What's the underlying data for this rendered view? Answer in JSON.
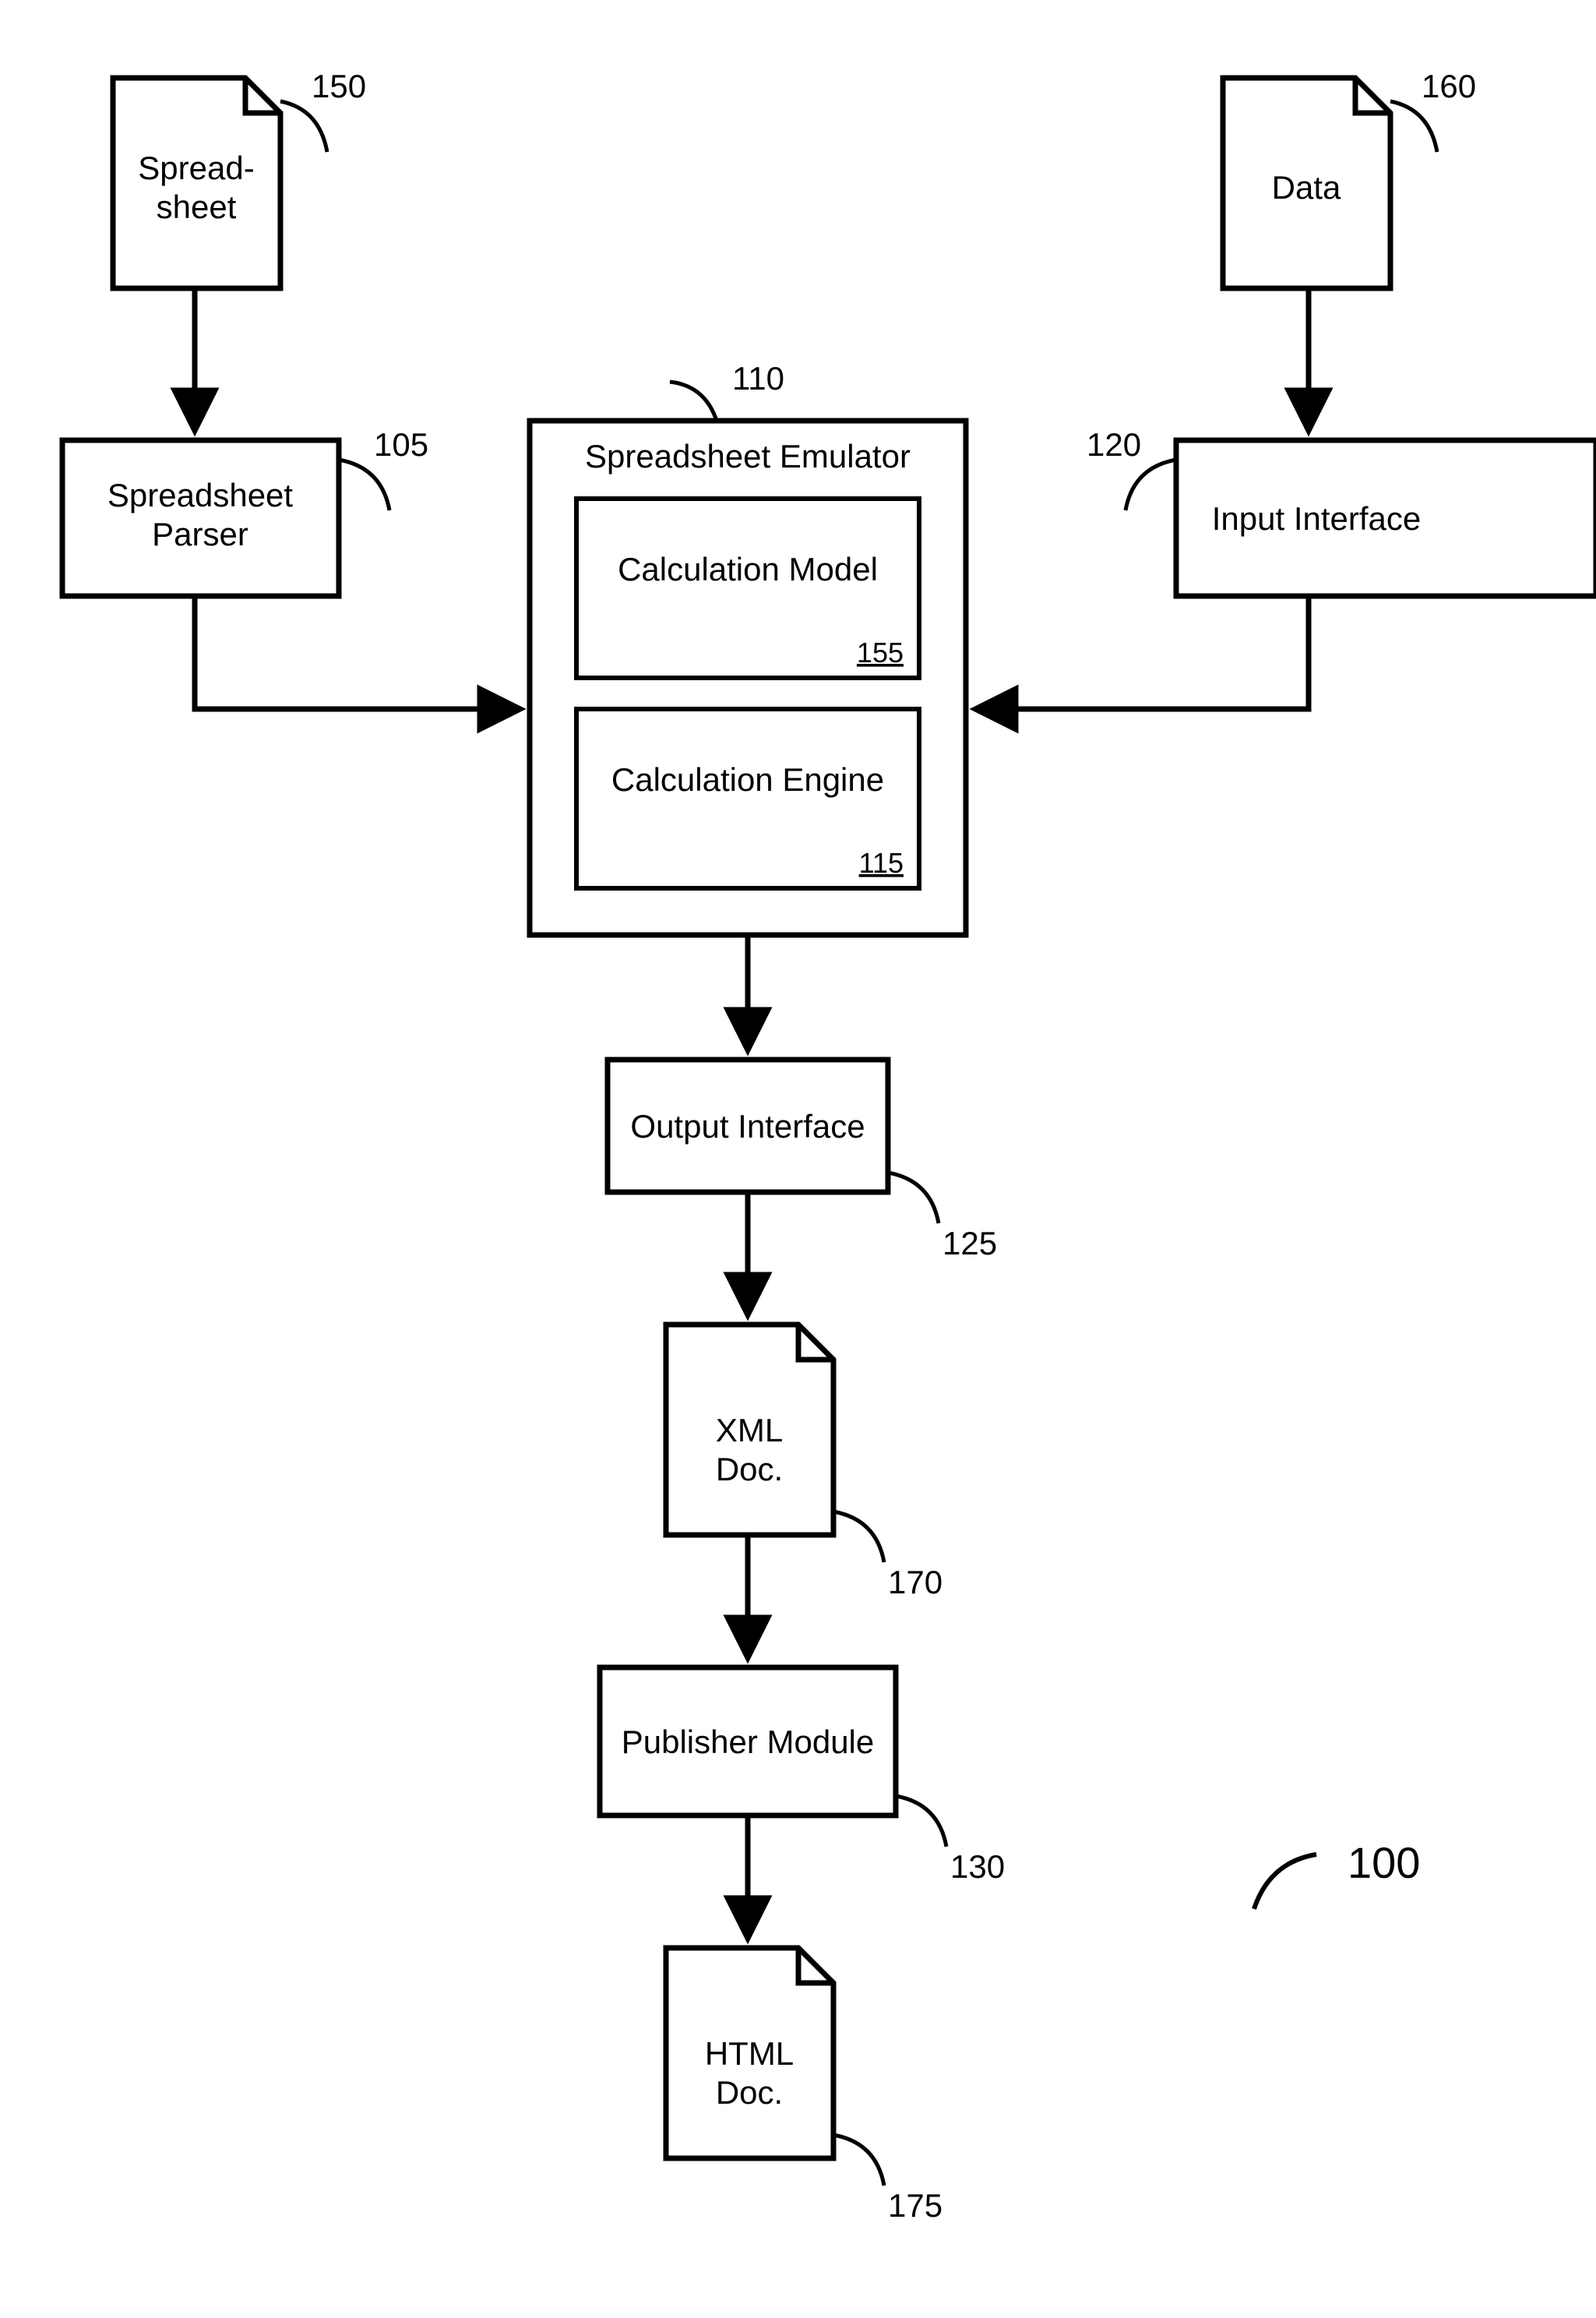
{
  "nodes": {
    "spreadsheet_doc": {
      "label1": "Spread-",
      "label2": "sheet",
      "ref": "150"
    },
    "data_doc": {
      "label1": "Data",
      "label2": "",
      "ref": "160"
    },
    "parser": {
      "label1": "Spreadsheet",
      "label2": "Parser",
      "ref": "105"
    },
    "input_interface": {
      "label": "Input Interface",
      "ref": "120"
    },
    "emulator": {
      "title": "Spreadsheet Emulator",
      "ref": "110"
    },
    "calc_model": {
      "label": "Calculation Model",
      "ref": "155"
    },
    "calc_engine": {
      "label": "Calculation Engine",
      "ref": "115"
    },
    "output_interface": {
      "label": "Output Interface",
      "ref": "125"
    },
    "xml_doc": {
      "label1": "XML",
      "label2": "Doc.",
      "ref": "170"
    },
    "publisher": {
      "label": "Publisher Module",
      "ref": "130"
    },
    "html_doc": {
      "label1": "HTML",
      "label2": "Doc.",
      "ref": "175"
    },
    "system": {
      "ref": "100"
    }
  }
}
